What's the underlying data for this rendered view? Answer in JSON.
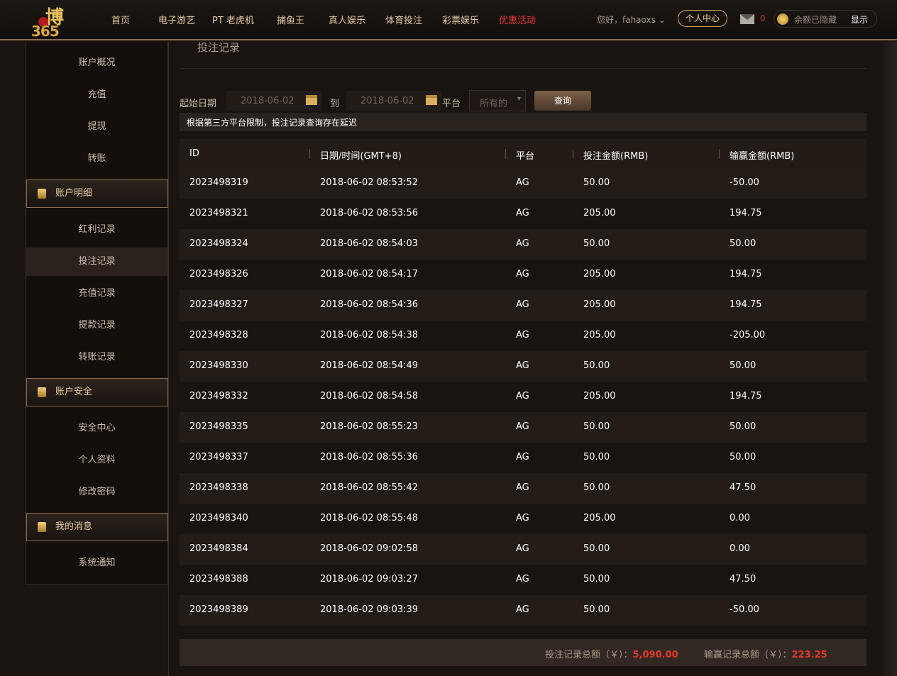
{
  "header": {
    "logo_text": "博365",
    "nav": [
      "首页",
      "电子游艺",
      "PT 老虎机",
      "捕鱼王",
      "真人娱乐",
      "体育投注",
      "彩票娱乐",
      "优惠活动"
    ],
    "greeting": "您好，fahaoxs",
    "personal_center": "个人中心",
    "mail_count": "0",
    "balance_hidden": "余额已隐藏",
    "show": "显示"
  },
  "sidebar": {
    "top_items": [
      "账户概况",
      "充值",
      "提现",
      "转账"
    ],
    "sections": [
      {
        "title": "账户明细",
        "items": [
          "红利记录",
          "投注记录",
          "充值记录",
          "提款记录",
          "转账记录"
        ]
      },
      {
        "title": "账户安全",
        "items": [
          "安全中心",
          "个人资料",
          "修改密码"
        ]
      },
      {
        "title": "我的消息",
        "items": [
          "系统通知"
        ]
      }
    ]
  },
  "main": {
    "title": "投注记录",
    "filter": {
      "start_label": "起始日期",
      "start": "2018-06-02",
      "to_label": "到",
      "end": "2018-06-02",
      "platform_label": "平台",
      "platform": "所有的",
      "query": "查询"
    },
    "notice": "根据第三方平台限制，投注记录查询存在延迟",
    "columns": [
      "ID",
      "日期/时间(GMT+8)",
      "平台",
      "投注金额(RMB)",
      "输赢金额(RMB)"
    ],
    "rows": [
      [
        "2023498319",
        "2018-06-02 08:53:52",
        "AG",
        "50.00",
        "-50.00"
      ],
      [
        "2023498321",
        "2018-06-02 08:53:56",
        "AG",
        "205.00",
        "194.75"
      ],
      [
        "2023498324",
        "2018-06-02 08:54:03",
        "AG",
        "50.00",
        "50.00"
      ],
      [
        "2023498326",
        "2018-06-02 08:54:17",
        "AG",
        "205.00",
        "194.75"
      ],
      [
        "2023498327",
        "2018-06-02 08:54:36",
        "AG",
        "205.00",
        "194.75"
      ],
      [
        "2023498328",
        "2018-06-02 08:54:38",
        "AG",
        "205.00",
        "-205.00"
      ],
      [
        "2023498330",
        "2018-06-02 08:54:49",
        "AG",
        "50.00",
        "50.00"
      ],
      [
        "2023498332",
        "2018-06-02 08:54:58",
        "AG",
        "205.00",
        "194.75"
      ],
      [
        "2023498335",
        "2018-06-02 08:55:23",
        "AG",
        "50.00",
        "50.00"
      ],
      [
        "2023498337",
        "2018-06-02 08:55:36",
        "AG",
        "50.00",
        "50.00"
      ],
      [
        "2023498338",
        "2018-06-02 08:55:42",
        "AG",
        "50.00",
        "47.50"
      ],
      [
        "2023498340",
        "2018-06-02 08:55:48",
        "AG",
        "205.00",
        "0.00"
      ],
      [
        "2023498384",
        "2018-06-02 09:02:58",
        "AG",
        "50.00",
        "0.00"
      ],
      [
        "2023498388",
        "2018-06-02 09:03:27",
        "AG",
        "50.00",
        "47.50"
      ],
      [
        "2023498389",
        "2018-06-02 09:03:39",
        "AG",
        "50.00",
        "-50.00"
      ]
    ],
    "footer": {
      "bet_total_label": "投注记录总额（￥）：",
      "bet_total": "5,090.00",
      "win_total_label": "输赢记录总额（￥）：",
      "win_total": "223.25"
    }
  }
}
